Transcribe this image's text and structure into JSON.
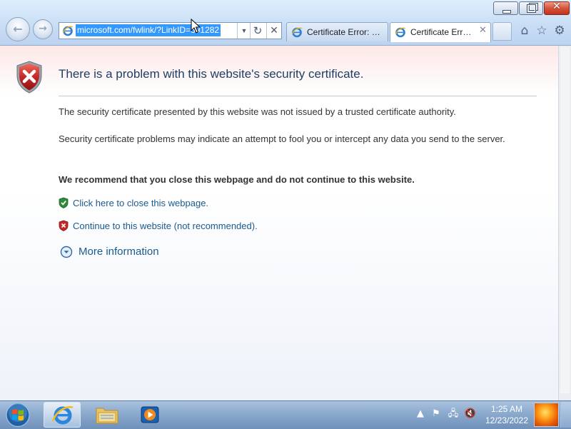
{
  "window": {
    "minimize_icon": "minimize-icon",
    "maximize_icon": "restore-icon",
    "close_glyph": "✕"
  },
  "nav": {
    "back_glyph": "←",
    "forward_glyph": "→"
  },
  "address_bar": {
    "url": "microsoft.com/fwlink/?LinkID=391282",
    "dropdown_glyph": "▼",
    "refresh_glyph": "↻",
    "stop_glyph": "✕"
  },
  "tabs": [
    {
      "label": "Certificate Error: N...",
      "active": false
    },
    {
      "label": "Certificate Error...",
      "active": true,
      "close_glyph": "✕"
    }
  ],
  "command_icons": {
    "home": "⌂",
    "favorites": "☆",
    "tools": "⚙"
  },
  "page": {
    "title": "There is a problem with this website's security certificate.",
    "para_1": "The security certificate presented by this website was not issued by a trusted certificate authority.",
    "para_2": "Security certificate problems may indicate an attempt to fool you or intercept any data you send to the server.",
    "recommendation": "We recommend that you close this webpage and do not continue to this website.",
    "close_link": "Click here to close this webpage.",
    "continue_link": "Continue to this website (not recommended).",
    "more_info": "More information"
  },
  "taskbar": {
    "tray": {
      "expand_glyph": "▲",
      "flag_glyph": "⚑",
      "network_glyph": "🖧",
      "volume_glyph": "🔇"
    },
    "clock_time": "1:25 AM",
    "clock_date": "12/23/2022"
  },
  "colors": {
    "link": "#1a5a8e",
    "title": "#1f3f66",
    "selection": "#3399ff",
    "error_red": "#c62828",
    "safe_green": "#2e8b3a"
  }
}
